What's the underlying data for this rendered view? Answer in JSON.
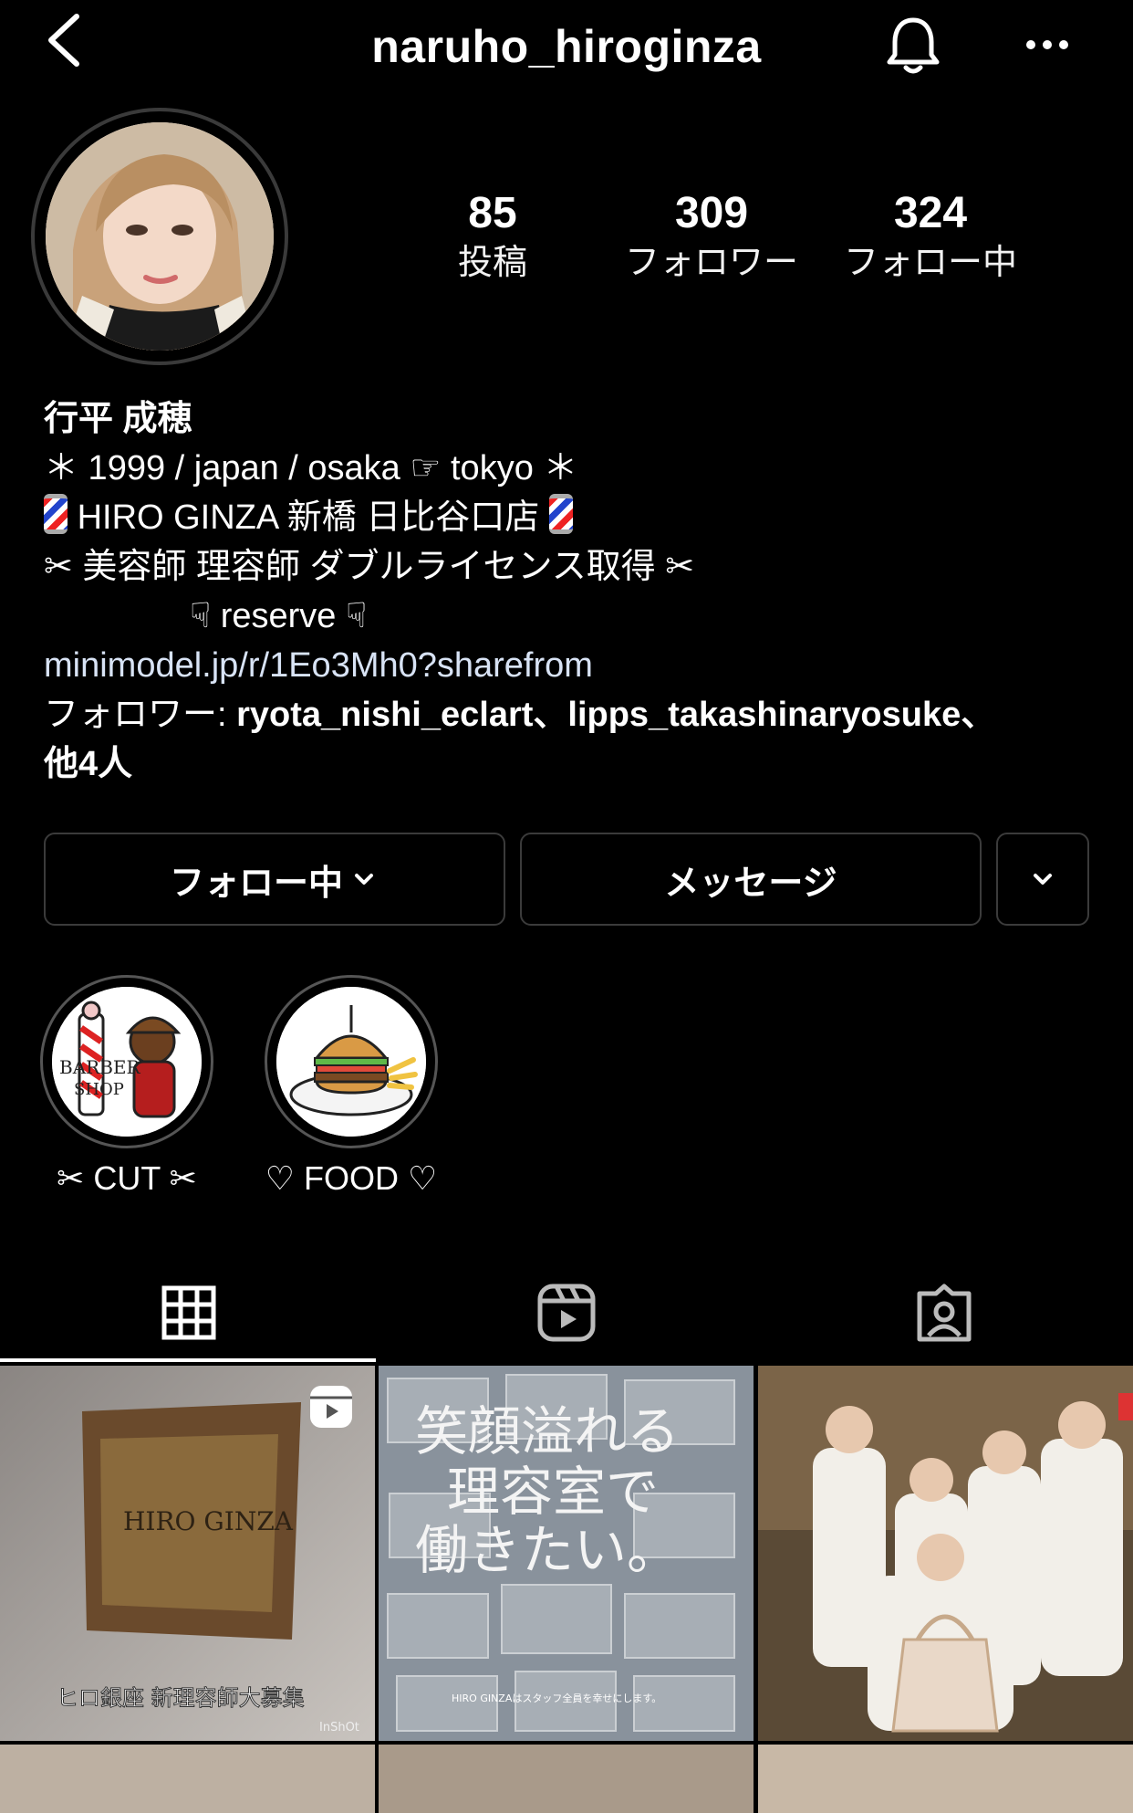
{
  "header": {
    "username": "naruho_hiroginza",
    "icons": [
      "back-chevron-icon",
      "bell-icon",
      "more-dots-icon"
    ]
  },
  "profile": {
    "stats": [
      {
        "value": "85",
        "label": "投稿"
      },
      {
        "value": "309",
        "label": "フォロワー"
      },
      {
        "value": "324",
        "label": "フォロー中"
      }
    ],
    "display_name": "行平 成穂",
    "bio": {
      "line1": "＊ 1999 / japan / osaka ☞ tokyo ＊",
      "line2": "HIRO GINZA 新橋 日比谷口店",
      "line3": "✂︎ 美容師 理容師 ダブルライセンス取得 ✂︎",
      "line4": "☟ reserve ☟",
      "link": "minimodel.jp/r/1Eo3Mh0?sharefrom"
    },
    "followed_by": {
      "prefix": "フォロワー: ",
      "names": "ryota_nishi_eclart、lipps_takashinaryosuke、",
      "suffix": "他4人"
    }
  },
  "actions": {
    "follow_label": "フォロー中",
    "message_label": "メッセージ"
  },
  "highlights": [
    {
      "label": "✂︎  CUT  ✂︎",
      "icon": "barber-shop-image"
    },
    {
      "label": "♡ FOOD ♡",
      "icon": "burger-image"
    }
  ],
  "tabs": [
    "grid-icon",
    "reels-icon",
    "tagged-icon"
  ],
  "posts": [
    {
      "type": "reel",
      "caption": "ヒロ銀座  新理容師大募集",
      "sign_text": "HIRO GINZA",
      "watermark": "InShOt"
    },
    {
      "type": "image",
      "headline": [
        "笑顔溢れる",
        "理容室で",
        "働きたい。"
      ],
      "footer": "HIRO GINZAはスタッフ全員を幸せにします。"
    },
    {
      "type": "image",
      "caption": ""
    }
  ]
}
